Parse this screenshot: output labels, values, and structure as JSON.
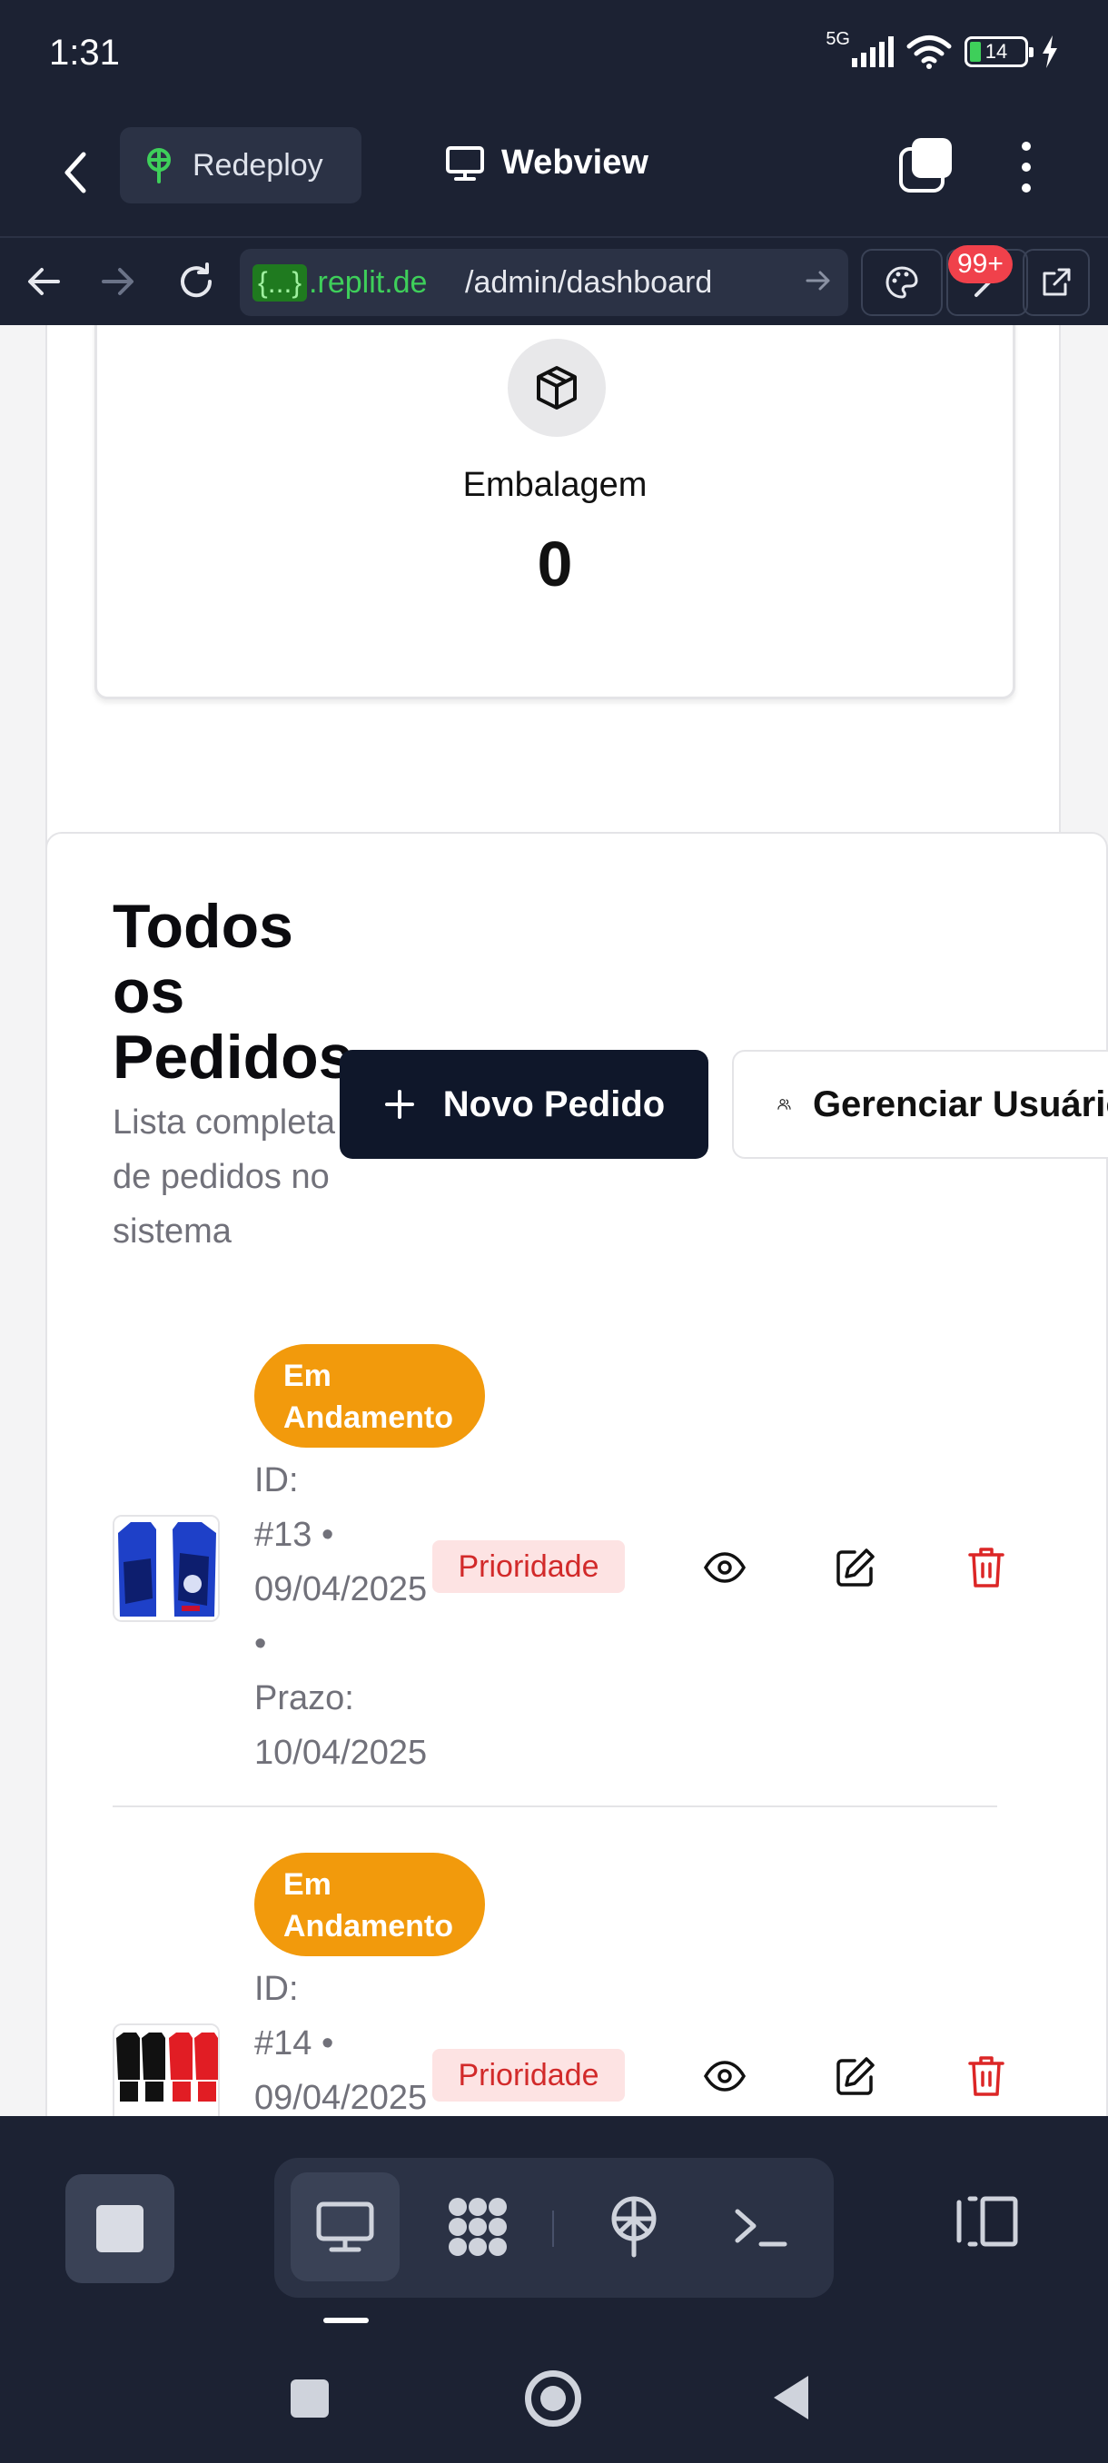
{
  "status_bar": {
    "time": "1:31",
    "network": "5G",
    "battery": "14"
  },
  "app_bar": {
    "redeploy_label": "Redeploy",
    "webview_title": "Webview"
  },
  "browser": {
    "url_badge": "{...}",
    "url_host": ".replit.de",
    "url_path": "/admin/dashboard",
    "notification_count": "99+"
  },
  "stat_card": {
    "label": "Embalagem",
    "value": "0"
  },
  "orders": {
    "title": "Todos os Pedidos",
    "subtitle": "Lista completa de pedidos no sistema",
    "new_order_label": "Novo Pedido",
    "manage_users_label": "Gerenciar Usuários",
    "items": [
      {
        "status": "Em Andamento",
        "id_label": "ID:",
        "id": "#13 •",
        "date": "09/04/2025",
        "bullet": "•",
        "deadline_label": "Prazo:",
        "deadline": "10/04/2025",
        "priority": "Prioridade"
      },
      {
        "status": "Em Andamento",
        "id_label": "ID:",
        "id": "#14 •",
        "date": "09/04/2025",
        "priority": "Prioridade"
      }
    ]
  },
  "colors": {
    "dark_bg": "#1c2233",
    "status_orange": "#f29a0c",
    "priority_red": "#d22a2a",
    "url_green": "#3ecf5a"
  }
}
